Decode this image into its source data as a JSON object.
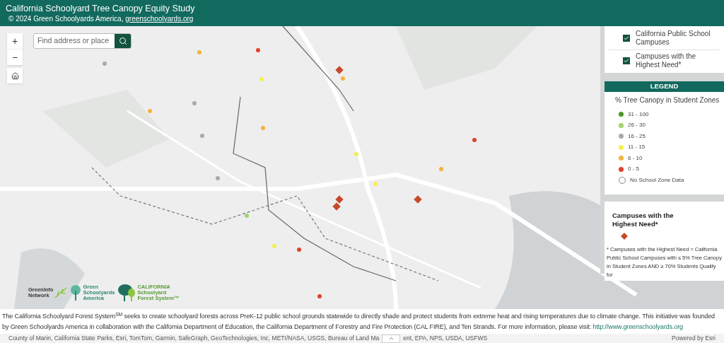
{
  "header": {
    "title": "California Schoolyard Tree Canopy Equity Study",
    "copyright": "© 2024 Green Schoolyards America, ",
    "link": "greenschoolyards.org"
  },
  "zoom_buttons": [
    "+",
    "−"
  ],
  "search": {
    "placeholder": "Find address or place"
  },
  "layers": [
    {
      "label": "California Public School Campuses",
      "checked": true
    },
    {
      "label": "Campuses with the Highest Need*",
      "checked": true
    }
  ],
  "legend": {
    "heading": "LEGEND",
    "subtitle": "% Tree Canopy in Student Zones",
    "items": [
      {
        "label": "31 - 100",
        "color": "#4c9a2a",
        "kind": "dot"
      },
      {
        "label": "26 - 30",
        "color": "#a3d36b",
        "kind": "dot"
      },
      {
        "label": "16 - 25",
        "color": "#a9a9a9",
        "kind": "dot"
      },
      {
        "label": "11 - 15",
        "color": "#f5f04a",
        "kind": "dot"
      },
      {
        "label": "6 - 10",
        "color": "#f2b33d",
        "kind": "dot"
      },
      {
        "label": "0 - 5",
        "color": "#e0412b",
        "kind": "dot"
      },
      {
        "label": "No School Zone Data",
        "color": "#ffffff",
        "kind": "ring"
      }
    ]
  },
  "highest_need": {
    "title": "Campuses with the Highest Need*"
  },
  "note": "* Campuses with the Highest Need = California Public School Campuses with ≤ 5% Tree Canopy in Student Zones AND ≥ 70% Students Qualify for",
  "logos": [
    {
      "kind": "greeninfo",
      "lines": [
        "GreenInfo",
        "Network"
      ]
    },
    {
      "kind": "gsa",
      "lines": [
        "Green",
        "Schoolyards",
        "America"
      ]
    },
    {
      "kind": "csfs",
      "lines": [
        "CALIFORNIA",
        "Schoolyard",
        "Forest System™"
      ]
    }
  ],
  "description": {
    "text": "The California Schoolyard Forest System$^{SM}$ seeks to create schoolyard forests across PreK-12 public school grounds statewide to directly shade and protect students from extreme heat and rising temperatures due to climate change. This initiative was founded by Green Schoolyards America in collaboration with the California Department of Education, the California Department of Forestry and Fire Protection (CAL FIRE), and Ten Strands. For more information, please visit: ",
    "link": "http://www.greenschoolyards.org"
  },
  "attribution": {
    "text_before": "County of Marin, California State Parks, Esri, TomTom, Garmin, SafeGraph, GeoTechnologies, Inc, METI/NASA, USGS, Bureau of Land Ma",
    "text_after": "ent, EPA, NPS, USDA, USFWS",
    "powered": "Powered by Esri"
  }
}
